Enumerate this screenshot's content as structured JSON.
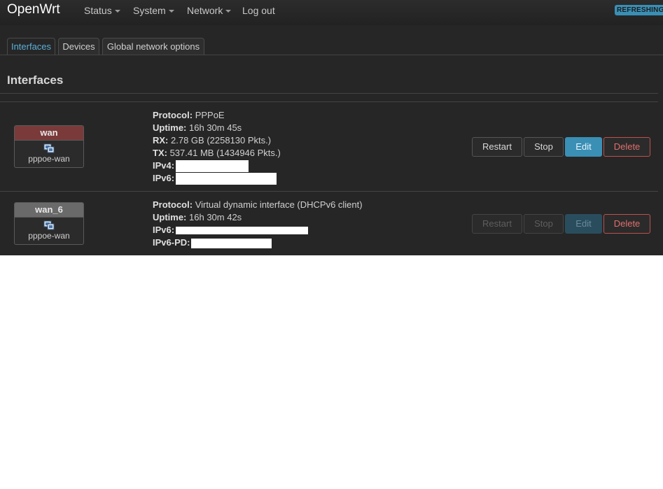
{
  "navbar": {
    "brand": "OpenWrt",
    "menu": [
      {
        "label": "Status",
        "has_dropdown": true
      },
      {
        "label": "System",
        "has_dropdown": true
      },
      {
        "label": "Network",
        "has_dropdown": true
      },
      {
        "label": "Log out",
        "has_dropdown": false
      }
    ],
    "refresh_badge": "REFRESHING"
  },
  "tabs": [
    {
      "label": "Interfaces",
      "active": true
    },
    {
      "label": "Devices",
      "active": false
    },
    {
      "label": "Global network options",
      "active": false
    }
  ],
  "section_title": "Interfaces",
  "interfaces": [
    {
      "name": "wan",
      "header_color": "#7a3a3a",
      "device": "pppoe-wan",
      "icon": "network-interface-icon",
      "details": [
        {
          "label": "Protocol:",
          "value": "PPPoE"
        },
        {
          "label": "Uptime:",
          "value": "16h 30m 45s"
        },
        {
          "label": "RX:",
          "value": "2.78 GB (2258130 Pkts.)"
        },
        {
          "label": "TX:",
          "value": "537.41 MB (1434946 Pkts.)"
        },
        {
          "label": "IPv4:",
          "value": ""
        },
        {
          "label": "IPv6:",
          "value": ""
        }
      ],
      "buttons": {
        "restart": "Restart",
        "stop": "Stop",
        "edit": "Edit",
        "delete": "Delete"
      },
      "buttons_disabled": false
    },
    {
      "name": "wan_6",
      "header_color": "#6a6a6a",
      "device": "pppoe-wan",
      "icon": "network-interface-icon",
      "details": [
        {
          "label": "Protocol:",
          "value": "Virtual dynamic interface (DHCPv6 client)"
        },
        {
          "label": "Uptime:",
          "value": "16h 30m 42s"
        },
        {
          "label": "IPv6:",
          "value": ""
        },
        {
          "label": "IPv6-PD:",
          "value": ""
        }
      ],
      "buttons": {
        "restart": "Restart",
        "stop": "Stop",
        "edit": "Edit",
        "delete": "Delete"
      },
      "buttons_disabled": true
    }
  ],
  "colors": {
    "background": "#262626",
    "accent": "#3a8fb5",
    "active_tab_text": "#5bb0d8",
    "delete_border": "#c0504d"
  }
}
